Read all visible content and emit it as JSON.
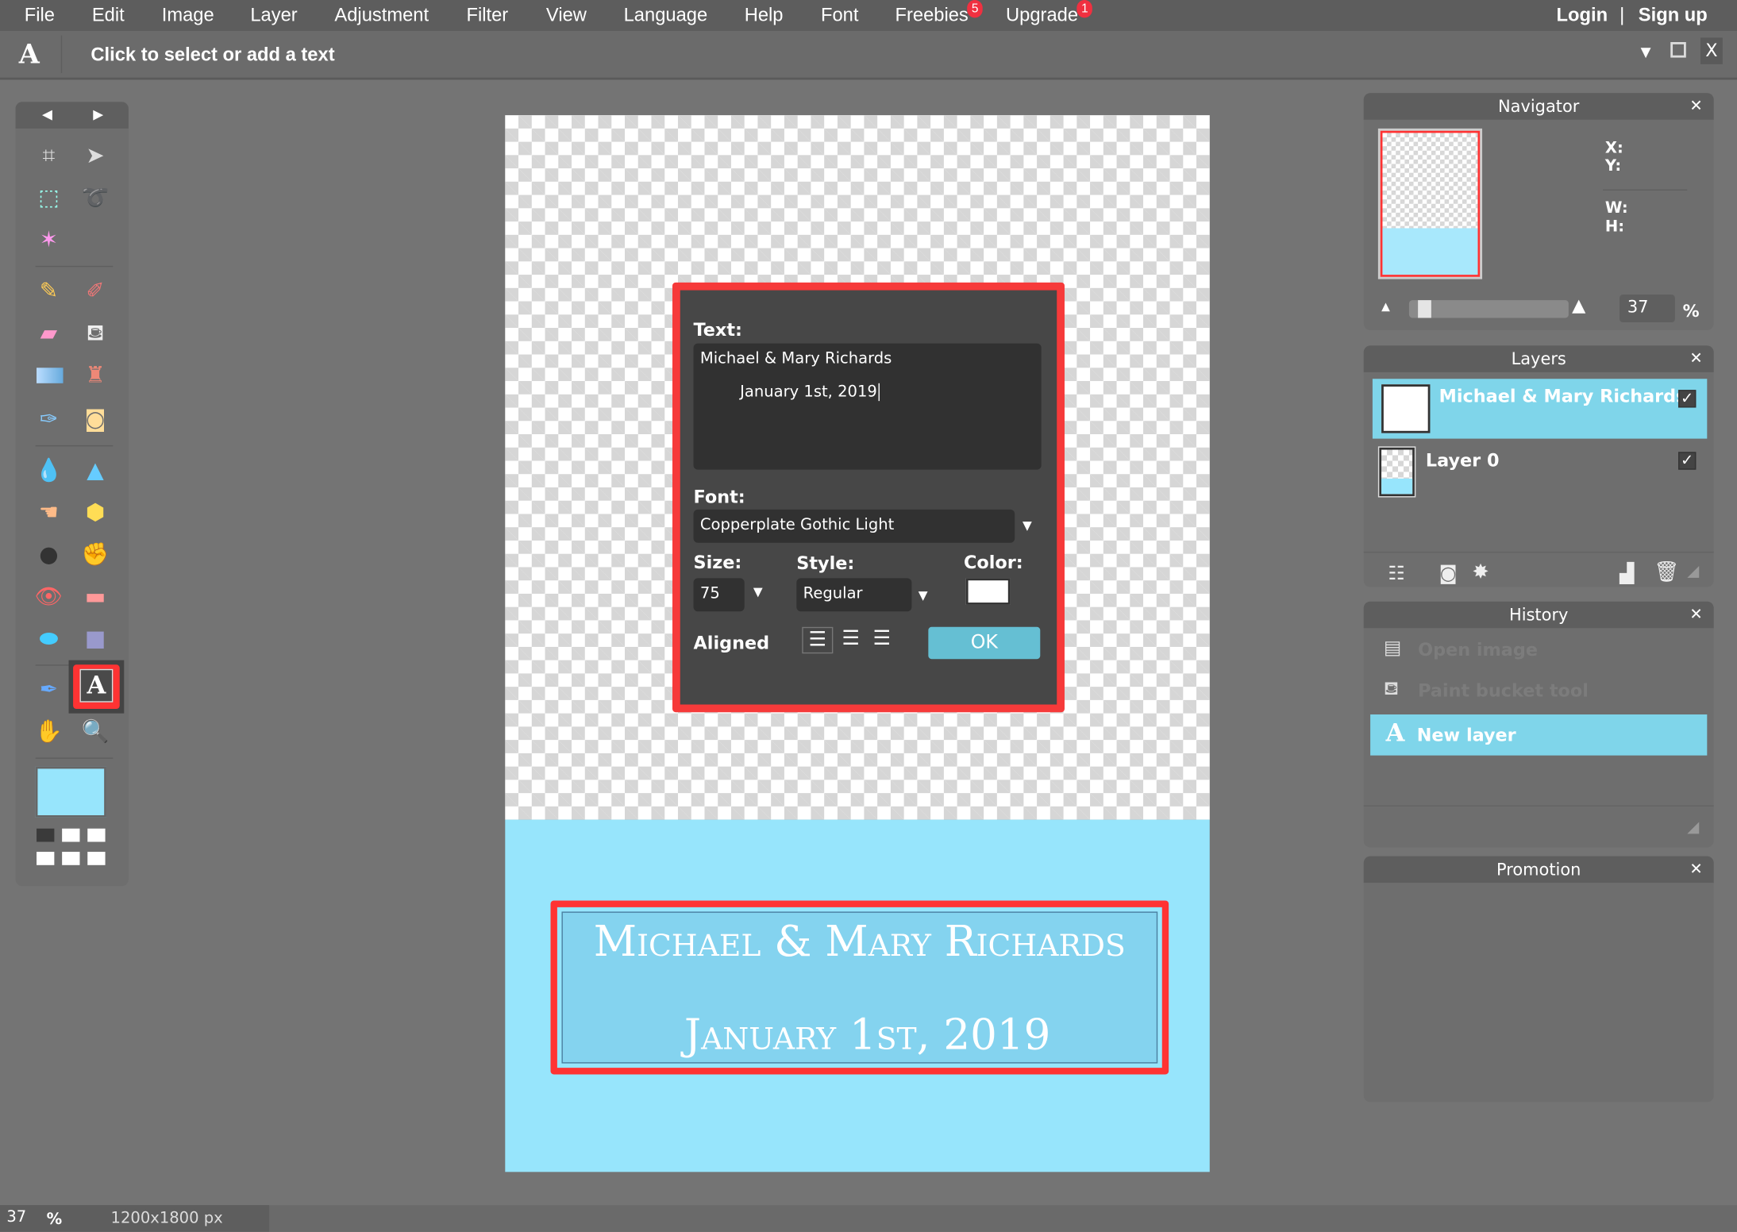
{
  "menu": {
    "items": [
      "File",
      "Edit",
      "Image",
      "Layer",
      "Adjustment",
      "Filter",
      "View",
      "Language",
      "Help",
      "Font",
      "Freebies",
      "Upgrade"
    ],
    "freebies_badge": "5",
    "upgrade_badge": "1",
    "login": "Login",
    "separator": "|",
    "signup": "Sign up"
  },
  "options": {
    "tool_glyph": "A",
    "hint": "Click to select or add a text"
  },
  "dialog": {
    "text_label": "Text:",
    "text_line1": "Michael & Mary Richards",
    "text_line2": "January 1st, 2019",
    "font_label": "Font:",
    "font_value": "Copperplate Gothic Light",
    "size_label": "Size:",
    "size_value": "75",
    "style_label": "Style:",
    "style_value": "Regular",
    "color_label": "Color:",
    "color_value": "#ffffff",
    "aligned_label": "Aligned",
    "ok": "OK"
  },
  "canvas": {
    "line1": "Michael & Mary Richards",
    "line2": "January 1st, 2019",
    "bg_color": "#97e5fc"
  },
  "navigator": {
    "title": "Navigator",
    "x": "X:",
    "y": "Y:",
    "w": "W:",
    "h": "H:",
    "zoom": "37",
    "pct": "%"
  },
  "layers": {
    "title": "Layers",
    "items": [
      {
        "name": "Michael & Mary Richards",
        "visible": true,
        "selected": true
      },
      {
        "name": "Layer 0",
        "visible": true,
        "selected": false
      }
    ]
  },
  "history": {
    "title": "History",
    "items": [
      "Open image",
      "Paint bucket tool",
      "New layer"
    ]
  },
  "promotion": {
    "title": "Promotion"
  },
  "status": {
    "zoom": "37",
    "pct": "%",
    "size": "1200x1800 px"
  },
  "accent": "#7fd5ea",
  "highlight": "#f63a3a"
}
